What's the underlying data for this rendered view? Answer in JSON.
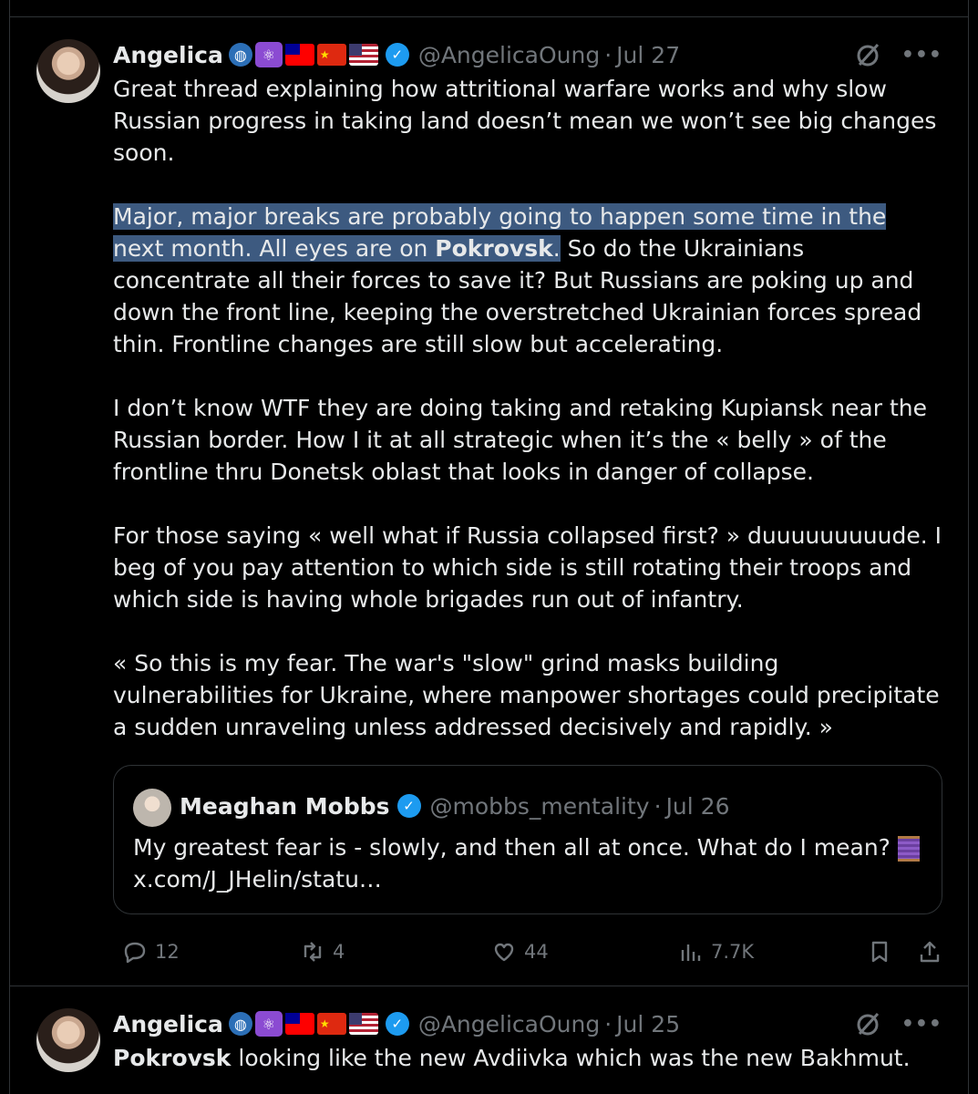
{
  "tweet1": {
    "name": "Angelica",
    "emoji_icons": [
      "globe-icon",
      "atom-icon",
      "taiwan-flag",
      "china-flag",
      "us-flag"
    ],
    "handle": "@AngelicaOung",
    "date": "Jul 27",
    "paragraphs": {
      "p1": "Great thread explaining how attritional warfare works and why slow Russian progress in taking land doesn’t mean we won’t see big changes soon.",
      "p2_highlight": "Major, major breaks are probably going to happen some time in the next month. All eyes are on ",
      "p2_bold": "Pokrovsk",
      "p2_highlight_end": ".",
      "p2_rest": " So do the Ukrainians concentrate all their forces to save it? But Russians are poking up and down the front line, keeping the overstretched Ukrainian forces spread thin. Frontline changes are still slow but accelerating.",
      "p3": "I don’t know WTF they are doing taking and retaking Kupiansk near the Russian border. How I it at all strategic when it’s the « belly » of the frontline thru Donetsk oblast that looks in danger of collapse.",
      "p4": "For those saying « well what if Russia collapsed first? » duuuuuuuuude. I beg of you pay attention to which side is still rotating their troops and which side is having whole brigades run out of infantry.",
      "p5": "« So this is my fear. The war's \"slow\" grind masks building vulnerabilities for Ukraine, where manpower shortages could precipitate a sudden unraveling unless addressed decisively and rapidly. »"
    },
    "quote": {
      "name": "Meaghan Mobbs",
      "handle": "@mobbs_mentality",
      "date": "Jul 26",
      "text": "My greatest fear is - slowly, and then all at once. What do I mean?",
      "link": "x.com/J_JHelin/statu…"
    },
    "stats": {
      "replies": "12",
      "retweets": "4",
      "likes": "44",
      "views": "7.7K"
    }
  },
  "tweet2": {
    "name": "Angelica",
    "handle": "@AngelicaOung",
    "date": "Jul 25",
    "text_bold": "Pokrovsk",
    "text_rest": " looking like the new Avdiivka  which was the new Bakhmut."
  },
  "separator": "·",
  "colors": {
    "background": "#000000",
    "text": "#e7e9ea",
    "muted": "#71767b",
    "border": "#2f3336",
    "verified": "#1d9bf0",
    "highlight": "#3d5a80"
  }
}
